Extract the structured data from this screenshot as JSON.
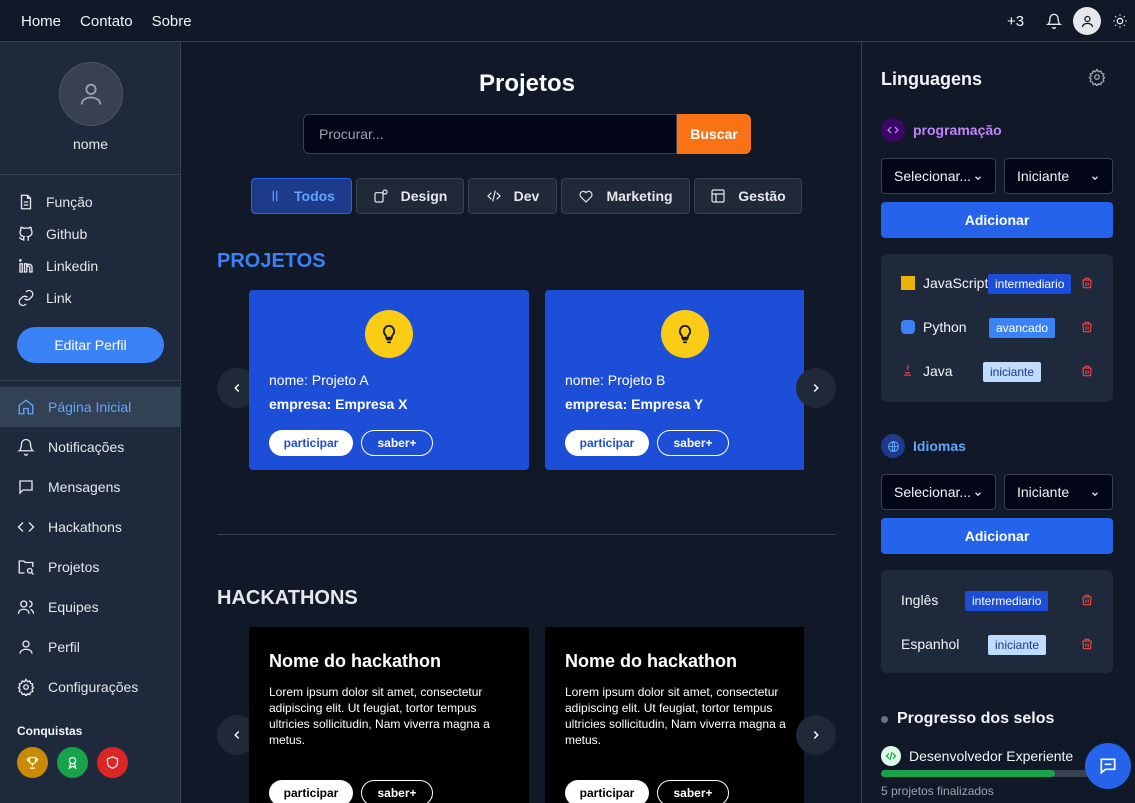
{
  "nav": {
    "links": [
      "Home",
      "Contato",
      "Sobre"
    ],
    "badge_count": "+3"
  },
  "profile": {
    "name": "nome",
    "edit_label": "Editar Perfil"
  },
  "profile_links": [
    "Função",
    "Github",
    "Linkedin",
    "Link"
  ],
  "menu": [
    "Página Inicial",
    "Notificações",
    "Mensagens",
    "Hackathons",
    "Projetos",
    "Equipes",
    "Perfil",
    "Configurações"
  ],
  "conquistas_title": "Conquistas",
  "main": {
    "title": "Projetos",
    "search_placeholder": "Procurar...",
    "search_button": "Buscar",
    "filters": [
      "Todos",
      "Design",
      "Dev",
      "Marketing",
      "Gestão"
    ],
    "projects_heading": "PROJETOS",
    "projects": [
      {
        "name": "nome: Projeto A",
        "company": "empresa: Empresa X"
      },
      {
        "name": "nome: Projeto B",
        "company": "empresa: Empresa Y"
      }
    ],
    "btn_participar": "participar",
    "btn_saber": "saber+",
    "hackathons_heading": "HACKATHONS",
    "hackathons": [
      {
        "title": "Nome do hackathon",
        "desc": "Lorem ipsum dolor sit amet, consectetur adipiscing elit. Ut feugiat, tortor tempus ultricies sollicitudin, Nam viverra magna a metus."
      },
      {
        "title": "Nome do hackathon",
        "desc": "Lorem ipsum dolor sit amet, consectetur adipiscing elit. Ut feugiat, tortor tempus ultricies sollicitudin, Nam viverra magna a metus."
      }
    ]
  },
  "right": {
    "title": "Linguagens",
    "prog_label": "programação",
    "select_placeholder": "Selecionar...",
    "level_default": "Iniciante",
    "add_label": "Adicionar",
    "languages": [
      {
        "name": "JavaScript",
        "level": "intermediario"
      },
      {
        "name": "Python",
        "level": "avancado"
      },
      {
        "name": "Java",
        "level": "iniciante"
      }
    ],
    "idiomas_label": "Idiomas",
    "idiomas": [
      {
        "name": "Inglês",
        "level": "intermediario"
      },
      {
        "name": "Espanhol",
        "level": "iniciante"
      }
    ],
    "progress_title": "Progresso dos selos",
    "badge_name": "Desenvolvedor Experiente",
    "badge_progress": 0.75,
    "badge_sub": "5 projetos finalizados"
  },
  "colors": {
    "accent": "#3b82f6",
    "search_button": "#f97316",
    "project_card": "#1d4ed8",
    "bulb": "#facc15",
    "progress": "#16a34a"
  }
}
